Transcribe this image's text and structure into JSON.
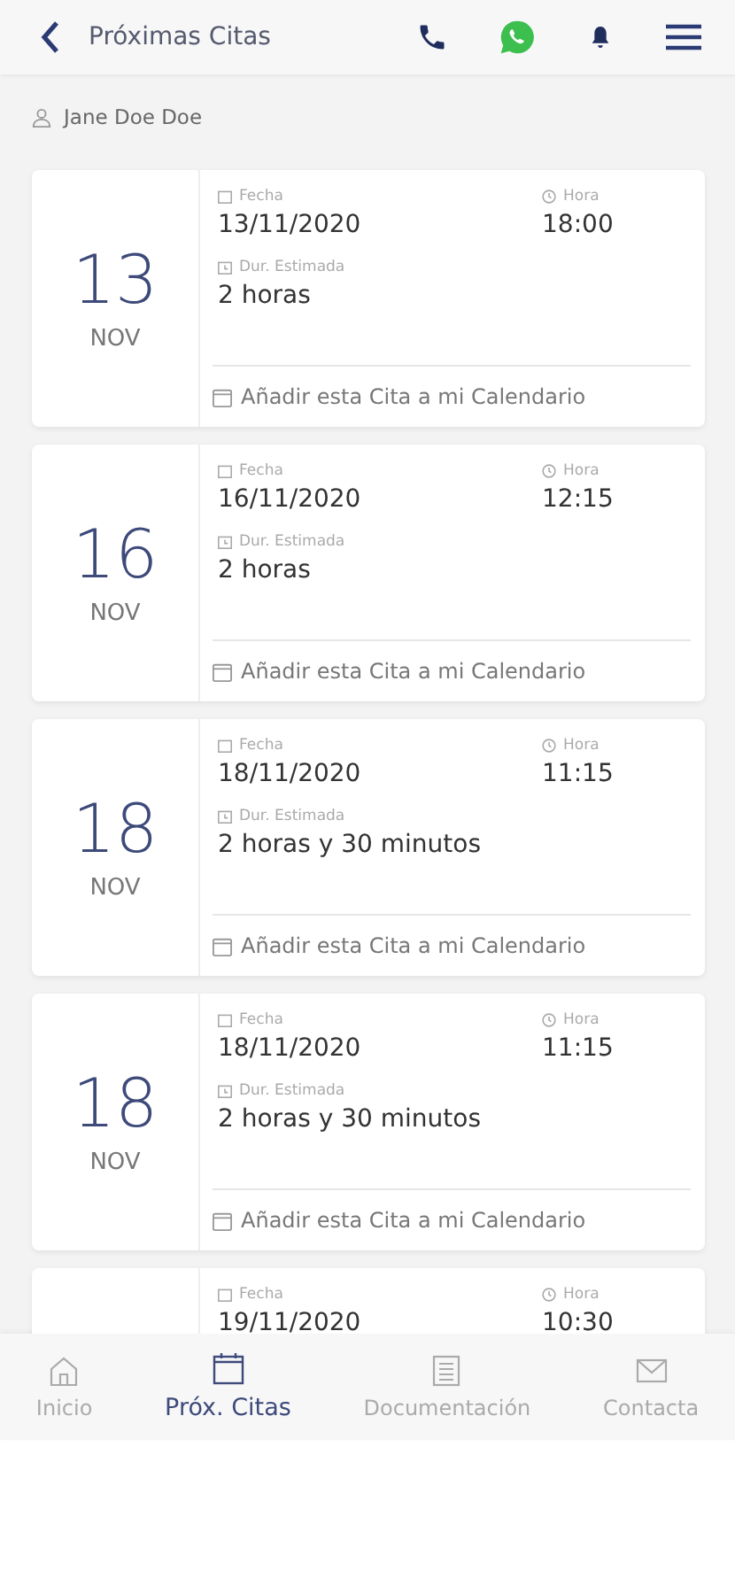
{
  "header": {
    "title": "Próximas Citas"
  },
  "user": {
    "name": "Jane Doe Doe"
  },
  "appointments": [
    {
      "day": "13",
      "month": "NOV",
      "date_label": "Fecha",
      "date": "13/11/2020",
      "time_label": "Hora",
      "time": "18:00",
      "duration_label": "Dur. Estimada",
      "duration": "2 horas",
      "calendar_link": "Añadir esta Cita a mi Calendario"
    },
    {
      "day": "16",
      "month": "NOV",
      "date_label": "Fecha",
      "date": "16/11/2020",
      "time_label": "Hora",
      "time": "12:15",
      "duration_label": "Dur. Estimada",
      "duration": "2 horas",
      "calendar_link": "Añadir esta Cita a mi Calendario"
    },
    {
      "day": "18",
      "month": "NOV",
      "date_label": "Fecha",
      "date": "18/11/2020",
      "time_label": "Hora",
      "time": "11:15",
      "duration_label": "Dur. Estimada",
      "duration": "2 horas y 30 minutos",
      "calendar_link": "Añadir esta Cita a mi Calendario"
    },
    {
      "day": "18",
      "month": "NOV",
      "date_label": "Fecha",
      "date": "18/11/2020",
      "time_label": "Hora",
      "time": "11:15",
      "duration_label": "Dur. Estimada",
      "duration": "2 horas y 30 minutos",
      "calendar_link": "Añadir esta Cita a mi Calendario"
    },
    {
      "date_label": "Fecha",
      "date": "19/11/2020",
      "time_label": "Hora",
      "time": "10:30"
    }
  ],
  "tabs": [
    {
      "kind": "home",
      "label": "Inicio",
      "selected": false
    },
    {
      "kind": "calendar",
      "label": "Próx. Citas",
      "selected": true
    },
    {
      "kind": "list",
      "label": "Documentación",
      "selected": false
    },
    {
      "kind": "mail",
      "label": "Contacta",
      "selected": false
    }
  ]
}
